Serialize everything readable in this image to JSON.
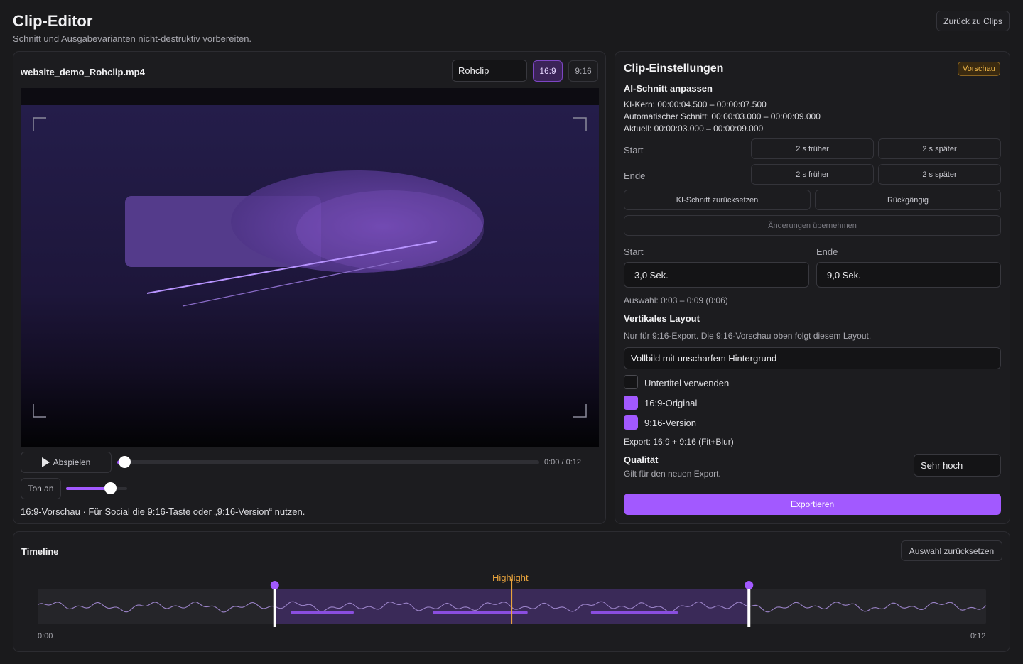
{
  "header": {
    "title": "Clip-Editor",
    "subtitle": "Schnitt und Ausgabevarianten nicht-destruktiv vorbereiten.",
    "back_button": "Zurück zu Clips"
  },
  "preview": {
    "filename": "website_demo_Rohclip.mp4",
    "source_select": "Rohclip",
    "aspect_16_9": "16:9",
    "aspect_9_16": "9:16",
    "play_button": "Abspielen",
    "time_display": "0:00 / 0:12",
    "playback_progress": 0.0,
    "sound_button": "Ton an",
    "volume_level": 0.72,
    "info_text": "16:9-Vorschau · Für Social die 9:16-Taste oder „9:16-Version“ nutzen."
  },
  "settings": {
    "title": "Clip-Einstellungen",
    "badge": "Vorschau",
    "ai_cut_heading": "AI-Schnitt anpassen",
    "ki_kern": "KI-Kern: 00:00:04.500 – 00:00:07.500",
    "auto_cut": "Automatischer Schnitt: 00:00:03.000 – 00:00:09.000",
    "current": "Aktuell: 00:00:03.000 – 00:00:09.000",
    "start_label": "Start",
    "end_label": "Ende",
    "earlier_button": "2 s früher",
    "later_button": "2 s später",
    "reset_ai_button": "KI-Schnitt zurücksetzen",
    "undo_button": "Rückgängig",
    "apply_button": "Änderungen übernehmen",
    "start_field_label": "Start",
    "end_field_label": "Ende",
    "start_value": "3,0 Sek.",
    "end_value": "9,0 Sek.",
    "selection_text": "Auswahl: 0:03 – 0:09 (0:06)",
    "vertical_heading": "Vertikales Layout",
    "vertical_info": "Nur für 9:16-Export. Die 9:16-Vorschau oben folgt diesem Layout.",
    "layout_select": "Vollbild mit unscharfem Hintergrund",
    "subtitles_label": "Untertitel verwenden",
    "subtitles_checked": false,
    "original_label": "16:9-Original",
    "original_checked": true,
    "vertical_label": "9:16-Version",
    "vertical_checked": true,
    "export_summary": "Export: 16:9 + 9:16 (Fit+Blur)",
    "quality_heading": "Qualität",
    "quality_info": "Gilt für den neuen Export.",
    "quality_select": "Sehr hoch",
    "export_button": "Exportieren"
  },
  "timeline": {
    "title": "Timeline",
    "reset_selection_button": "Auswahl zurücksetzen",
    "highlight_label": "Highlight",
    "start_time": "0:00",
    "end_time": "0:12",
    "duration_seconds": 12,
    "selection_start_seconds": 3,
    "selection_end_seconds": 9,
    "highlight_seconds": 6,
    "segments_seconds": [
      [
        3.2,
        4.0
      ],
      [
        5.0,
        6.2
      ],
      [
        7.0,
        8.1
      ]
    ]
  },
  "colors": {
    "accent": "#a259ff",
    "highlight": "#e8a33c",
    "badge": "#e8a33c"
  }
}
